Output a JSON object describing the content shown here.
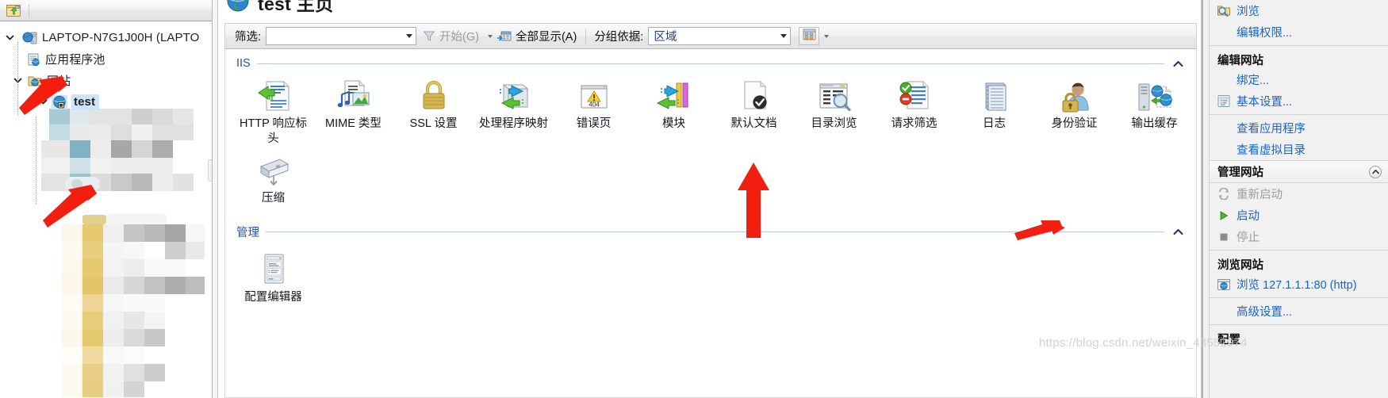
{
  "app": {
    "title": "test 主页",
    "title_name": "test",
    "title_suffix": "主页"
  },
  "toolbar": {
    "back_icon": "open-folder-arrow-icon"
  },
  "tree": {
    "root": {
      "label": "LAPTOP-N7G1J00H (LAPTO",
      "icon": "server-globe-icon"
    },
    "items": [
      {
        "label": "应用程序池",
        "icon": "app-pool-icon"
      },
      {
        "label": "网站",
        "icon": "sites-folder-icon"
      }
    ],
    "selected": {
      "label": "test",
      "icon": "site-globe-icon"
    }
  },
  "filter": {
    "label": "筛选:",
    "value": "",
    "placeholder": "",
    "go_label": "开始(G)",
    "go_accel": "G",
    "show_all_label": "全部显示(A)",
    "show_all_accel": "A",
    "group_by_label": "分组依据:",
    "group_by_value": "区域",
    "view_icon": "view-mode-icon"
  },
  "sections": [
    {
      "name": "IIS",
      "collapsed": false,
      "icons": [
        {
          "label": "HTTP 响应标头",
          "icon": "http-response-headers-icon"
        },
        {
          "label": "MIME 类型",
          "icon": "mime-types-icon"
        },
        {
          "label": "SSL 设置",
          "icon": "ssl-settings-icon"
        },
        {
          "label": "处理程序映射",
          "icon": "handler-mappings-icon"
        },
        {
          "label": "错误页",
          "icon": "error-pages-404-icon"
        },
        {
          "label": "模块",
          "icon": "modules-icon"
        },
        {
          "label": "默认文档",
          "icon": "default-document-icon"
        },
        {
          "label": "目录浏览",
          "icon": "directory-browsing-icon"
        },
        {
          "label": "请求筛选",
          "icon": "request-filtering-icon"
        },
        {
          "label": "日志",
          "icon": "logging-icon"
        },
        {
          "label": "身份验证",
          "icon": "authentication-icon"
        },
        {
          "label": "输出缓存",
          "icon": "output-caching-icon"
        },
        {
          "label": "压缩",
          "icon": "compression-icon"
        }
      ]
    },
    {
      "name": "管理",
      "collapsed": false,
      "icons": [
        {
          "label": "配置编辑器",
          "icon": "configuration-editor-icon"
        }
      ]
    }
  ],
  "actions": {
    "top": [
      {
        "label": "浏览",
        "icon": "browse-folder-icon",
        "enabled": true
      },
      {
        "label": "编辑权限...",
        "icon": null,
        "enabled": true
      }
    ],
    "edit_site": {
      "heading": "编辑网站",
      "items": [
        {
          "label": "绑定...",
          "icon": null,
          "enabled": true
        },
        {
          "label": "基本设置...",
          "icon": "basic-settings-icon",
          "enabled": true
        }
      ]
    },
    "view": [
      {
        "label": "查看应用程序",
        "icon": null,
        "enabled": true
      },
      {
        "label": "查看虚拟目录",
        "icon": null,
        "enabled": true
      }
    ],
    "manage_site": {
      "heading": "管理网站",
      "collapse_icon": "chevron-up-circle-icon",
      "items": [
        {
          "label": "重新启动",
          "icon": "restart-icon",
          "enabled": false
        },
        {
          "label": "启动",
          "icon": "start-play-icon",
          "enabled": true
        },
        {
          "label": "停止",
          "icon": "stop-square-icon",
          "enabled": false
        }
      ]
    },
    "browse_site": {
      "heading": "浏览网站",
      "items": [
        {
          "label": "浏览 127.1.1.1:80 (http)",
          "icon": "browse-globe-icon",
          "enabled": true
        }
      ]
    },
    "advanced": [
      {
        "label": "高级设置...",
        "icon": null,
        "enabled": true
      }
    ],
    "config_heading": "配置"
  },
  "watermark": "https://blog.csdn.net/weixin_43552974",
  "colors": {
    "link": "#1a64c8",
    "disabled": "#9c9c9c",
    "group_title": "#2850a0",
    "arrow": "#f21e0f",
    "selection": "#cde6f7"
  }
}
